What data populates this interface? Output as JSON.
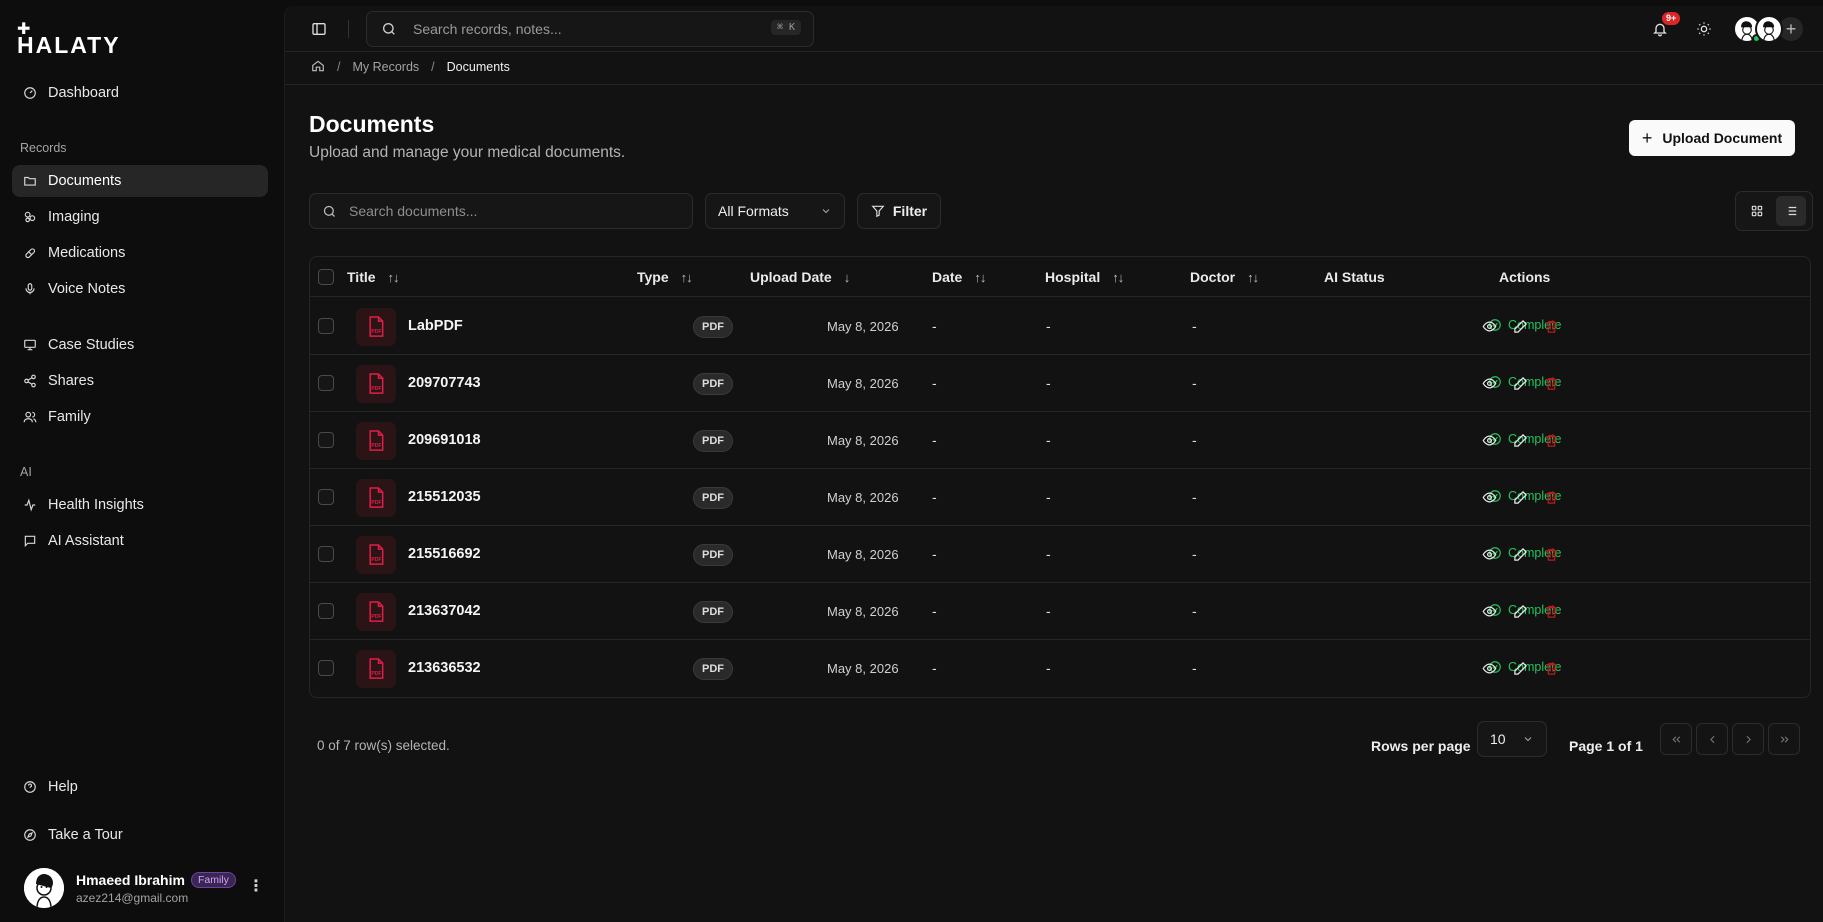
{
  "app": {
    "logo_text": "HALATY",
    "logo_mark": "✚"
  },
  "sidebar": {
    "dashboard": "Dashboard",
    "records_label": "Records",
    "records": [
      {
        "label": "Documents",
        "icon": "folder-icon",
        "active": true
      },
      {
        "label": "Imaging",
        "icon": "imaging-icon"
      },
      {
        "label": "Medications",
        "icon": "pill-icon"
      },
      {
        "label": "Voice Notes",
        "icon": "microphone-icon"
      }
    ],
    "other": [
      {
        "label": "Case Studies",
        "icon": "presentation-icon"
      },
      {
        "label": "Shares",
        "icon": "share-icon"
      },
      {
        "label": "Family",
        "icon": "users-icon"
      }
    ],
    "ai_label": "AI",
    "ai": [
      {
        "label": "Health Insights",
        "icon": "activity-icon"
      },
      {
        "label": "AI Assistant",
        "icon": "chat-icon"
      }
    ],
    "help": "Help",
    "tour": "Take a Tour",
    "user": {
      "name": "Hmaeed Ibrahim",
      "badge": "Family",
      "email": "azez214@gmail.com"
    }
  },
  "topbar": {
    "search_placeholder": "Search records, notes...",
    "shortcut": "⌘ K",
    "notifications_count": "9+"
  },
  "breadcrumb": {
    "level1": "My Records",
    "current": "Documents"
  },
  "page": {
    "title": "Documents",
    "subtitle": "Upload and manage your medical documents.",
    "upload_label": "Upload Document"
  },
  "toolbar": {
    "search_placeholder": "Search documents...",
    "format_value": "All Formats",
    "filter_label": "Filter"
  },
  "table": {
    "columns": {
      "title": "Title",
      "type": "Type",
      "upload_date": "Upload Date",
      "date": "Date",
      "hospital": "Hospital",
      "doctor": "Doctor",
      "ai_status": "AI Status",
      "actions": "Actions"
    },
    "rows": [
      {
        "title": "LabPDF",
        "type": "PDF",
        "upload_date": "May 8, 2026",
        "date": "-",
        "hospital": "-",
        "doctor": "-",
        "ai_status": "Complete"
      },
      {
        "title": "209707743",
        "type": "PDF",
        "upload_date": "May 8, 2026",
        "date": "-",
        "hospital": "-",
        "doctor": "-",
        "ai_status": "Complete"
      },
      {
        "title": "209691018",
        "type": "PDF",
        "upload_date": "May 8, 2026",
        "date": "-",
        "hospital": "-",
        "doctor": "-",
        "ai_status": "Complete"
      },
      {
        "title": "215512035",
        "type": "PDF",
        "upload_date": "May 8, 2026",
        "date": "-",
        "hospital": "-",
        "doctor": "-",
        "ai_status": "Complete"
      },
      {
        "title": "215516692",
        "type": "PDF",
        "upload_date": "May 8, 2026",
        "date": "-",
        "hospital": "-",
        "doctor": "-",
        "ai_status": "Complete"
      },
      {
        "title": "213637042",
        "type": "PDF",
        "upload_date": "May 8, 2026",
        "date": "-",
        "hospital": "-",
        "doctor": "-",
        "ai_status": "Complete"
      },
      {
        "title": "213636532",
        "type": "PDF",
        "upload_date": "May 8, 2026",
        "date": "-",
        "hospital": "-",
        "doctor": "-",
        "ai_status": "Complete"
      }
    ]
  },
  "footer": {
    "selection": "0 of 7 row(s) selected.",
    "rows_per_page_label": "Rows per page",
    "rows_per_page_value": "10",
    "page_info": "Page 1 of 1"
  },
  "colors": {
    "accent_green": "#22c55e",
    "pdf_red": "#e11d48",
    "delete_red": "#b91c1c",
    "badge_purple": "#c9a7f5"
  }
}
